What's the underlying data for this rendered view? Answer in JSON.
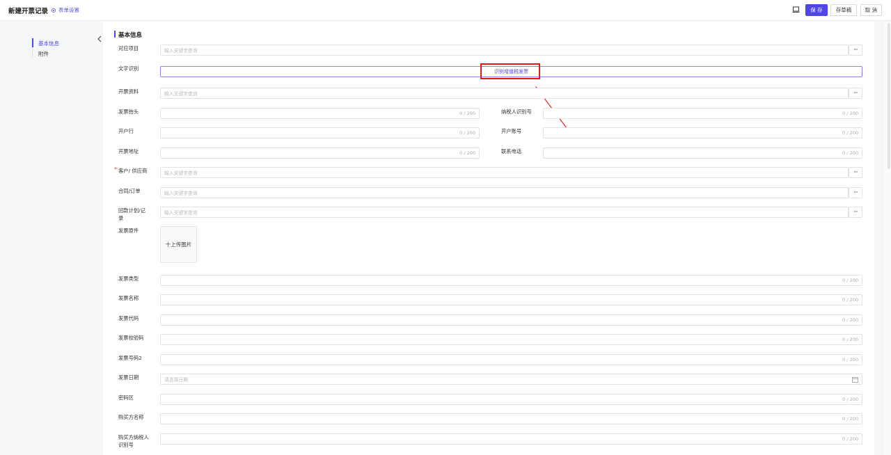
{
  "header": {
    "title": "新建开票记录",
    "form_settings": "表单设置",
    "save": "保 存",
    "draft": "存草稿",
    "cancel": "取 消"
  },
  "sidebar": {
    "items": [
      {
        "label": "基本信息",
        "active": true
      },
      {
        "label": "附件",
        "active": false
      }
    ]
  },
  "section": {
    "title": "基本信息"
  },
  "fields": {
    "project": {
      "label": "对应项目",
      "placeholder": "输入关键字查询"
    },
    "ocr": {
      "label": "文字识别",
      "button": "识别增值税发票"
    },
    "invoice_info": {
      "label": "开票资料",
      "placeholder": "输入关键字查询"
    },
    "invoice_title": {
      "label": "发票抬头",
      "counter": "0 / 200"
    },
    "taxpayer_id": {
      "label": "纳税人识别号",
      "counter": "0 / 200"
    },
    "bank": {
      "label": "开户行",
      "counter": "0 / 200"
    },
    "account": {
      "label": "开户账号",
      "counter": "0 / 200"
    },
    "address": {
      "label": "开票地址",
      "counter": "0 / 200"
    },
    "phone": {
      "label": "联系电话",
      "counter": "0 / 200"
    },
    "customer": {
      "label": "客户/ 供应商",
      "placeholder": "输入关键字查询",
      "required": "*"
    },
    "contract": {
      "label": "合同/订单",
      "placeholder": "输入关键字查询"
    },
    "payment_plan": {
      "label": "回款计划/记录",
      "label_line1": "回款计划/记",
      "label_line2": "录",
      "placeholder": "输入关键字查询"
    },
    "original": {
      "label": "发票原件",
      "upload": "十上传图片"
    },
    "invoice_type": {
      "label": "发票类型",
      "counter": "0 / 200"
    },
    "invoice_name": {
      "label": "发票名称",
      "counter": "0 / 200"
    },
    "invoice_code": {
      "label": "发票代码",
      "counter": "0 / 200"
    },
    "check_code": {
      "label": "发票校验码",
      "counter": "0 / 200"
    },
    "invoice_no": {
      "label": "发票号码2",
      "counter": "0 / 200"
    },
    "invoice_date": {
      "label": "发票日期",
      "placeholder": "请选择日期"
    },
    "cipher": {
      "label": "密码区",
      "counter": "0 / 200"
    },
    "buyer_name": {
      "label": "购买方名称",
      "counter": "0 / 200"
    },
    "buyer_tax_id": {
      "label_line1": "购买方纳税人",
      "label_line2": "识别号",
      "counter": "0 / 200"
    }
  },
  "colors": {
    "accent": "#4f46e5",
    "highlight": "#e01818"
  }
}
